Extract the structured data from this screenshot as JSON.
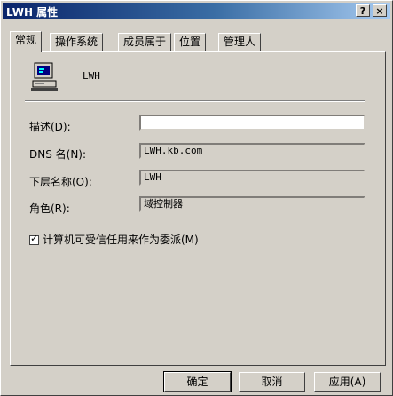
{
  "window": {
    "title": "LWH 属性",
    "help_label": "?",
    "close_label": "×"
  },
  "tabs": [
    {
      "label": "常规"
    },
    {
      "label": "操作系统"
    },
    {
      "label": "成员属于"
    },
    {
      "label": "位置"
    },
    {
      "label": "管理人"
    }
  ],
  "computer": {
    "icon": "computer-icon",
    "name": "LWH"
  },
  "fields": {
    "description": {
      "label": "描述(D):",
      "value": ""
    },
    "dns_name": {
      "label": "DNS 名(N):",
      "value": "LWH.kb.com"
    },
    "downlevel_name": {
      "label": "下层名称(O):",
      "value": "LWH"
    },
    "role": {
      "label": "角色(R):",
      "value": "域控制器"
    }
  },
  "checkbox": {
    "label": "计算机可受信任用来作为委派(M)",
    "checked": true
  },
  "buttons": {
    "ok": "确定",
    "cancel": "取消",
    "apply": "应用(A)"
  },
  "colors": {
    "title_start": "#0a246a",
    "title_end": "#a6caf0",
    "face": "#d4d0c8"
  }
}
